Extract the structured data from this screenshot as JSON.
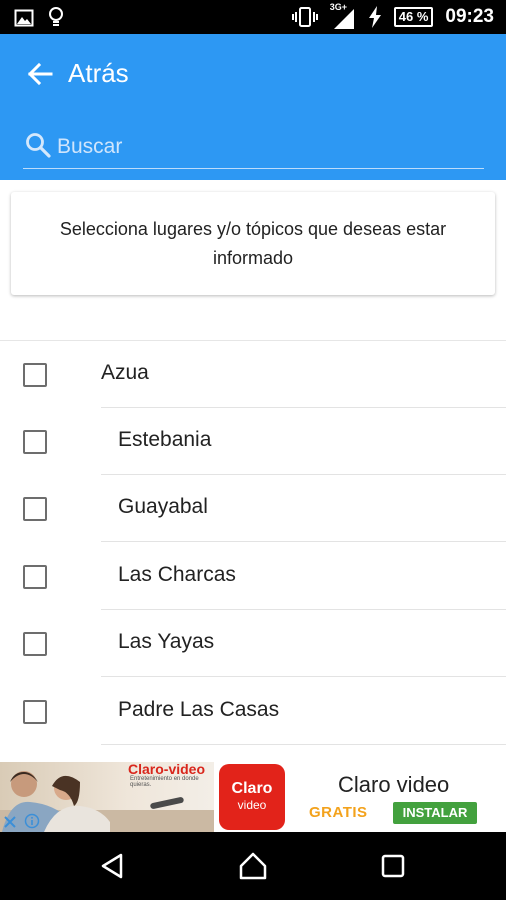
{
  "status_bar": {
    "network": "3G+",
    "battery": "46 %",
    "time": "09:23",
    "icons": [
      "image-icon",
      "lightbulb-icon",
      "vibrate-icon",
      "signal-icon",
      "charging-icon"
    ]
  },
  "app_bar": {
    "title": "Atrás",
    "search_placeholder": "Buscar",
    "search_value": "",
    "color": "#2d98f3"
  },
  "info": {
    "text": "Selecciona lugares y/o tópicos que deseas estar informado"
  },
  "items": [
    {
      "label": "Azua",
      "checked": false,
      "level": 0
    },
    {
      "label": "Estebania",
      "checked": false,
      "level": 1
    },
    {
      "label": "Guayabal",
      "checked": false,
      "level": 1
    },
    {
      "label": "Las Charcas",
      "checked": false,
      "level": 1
    },
    {
      "label": "Las Yayas",
      "checked": false,
      "level": 1
    },
    {
      "label": "Padre Las Casas",
      "checked": false,
      "level": 1
    }
  ],
  "ad": {
    "brand": "Claro-video",
    "brand_sub": "Entretenimiento en donde quieras.",
    "logo_line1": "Claro",
    "logo_line2": "video",
    "title": "Claro video",
    "tagline": "GRATIS",
    "cta": "INSTALAR",
    "colors": {
      "brand": "#e2231a",
      "gratis": "#f3a21c",
      "cta": "#43a13e"
    }
  },
  "nav_bar": {
    "icons": [
      "back-triangle-icon",
      "home-icon",
      "recents-square-icon"
    ]
  }
}
